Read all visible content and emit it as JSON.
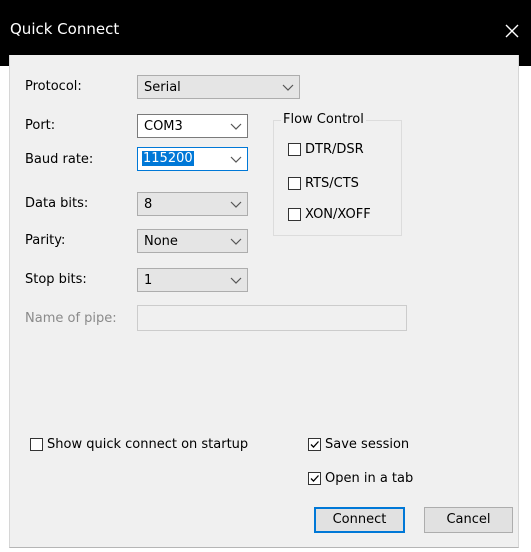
{
  "window": {
    "title": "Quick Connect",
    "close_icon": "close-icon"
  },
  "fields": {
    "protocol": {
      "label": "Protocol:",
      "value": "Serial"
    },
    "port": {
      "label": "Port:",
      "value": "COM3"
    },
    "baud_rate": {
      "label": "Baud rate:",
      "value": "115200"
    },
    "data_bits": {
      "label": "Data bits:",
      "value": "8"
    },
    "parity": {
      "label": "Parity:",
      "value": "None"
    },
    "stop_bits": {
      "label": "Stop bits:",
      "value": "1"
    },
    "name_of_pipe": {
      "label": "Name of pipe:",
      "value": ""
    }
  },
  "flow_control": {
    "title": "Flow Control",
    "options": [
      {
        "label": "DTR/DSR",
        "checked": false
      },
      {
        "label": "RTS/CTS",
        "checked": false
      },
      {
        "label": "XON/XOFF",
        "checked": false
      }
    ]
  },
  "options": {
    "show_on_startup": {
      "label": "Show quick connect on startup",
      "checked": false
    },
    "save_session": {
      "label": "Save session",
      "checked": true
    },
    "open_in_tab": {
      "label": "Open in a tab",
      "checked": true
    }
  },
  "buttons": {
    "connect": "Connect",
    "cancel": "Cancel"
  },
  "colors": {
    "accent": "#0078d7",
    "titlebar": "#000000",
    "dialog_bg": "#f0f0f0"
  }
}
